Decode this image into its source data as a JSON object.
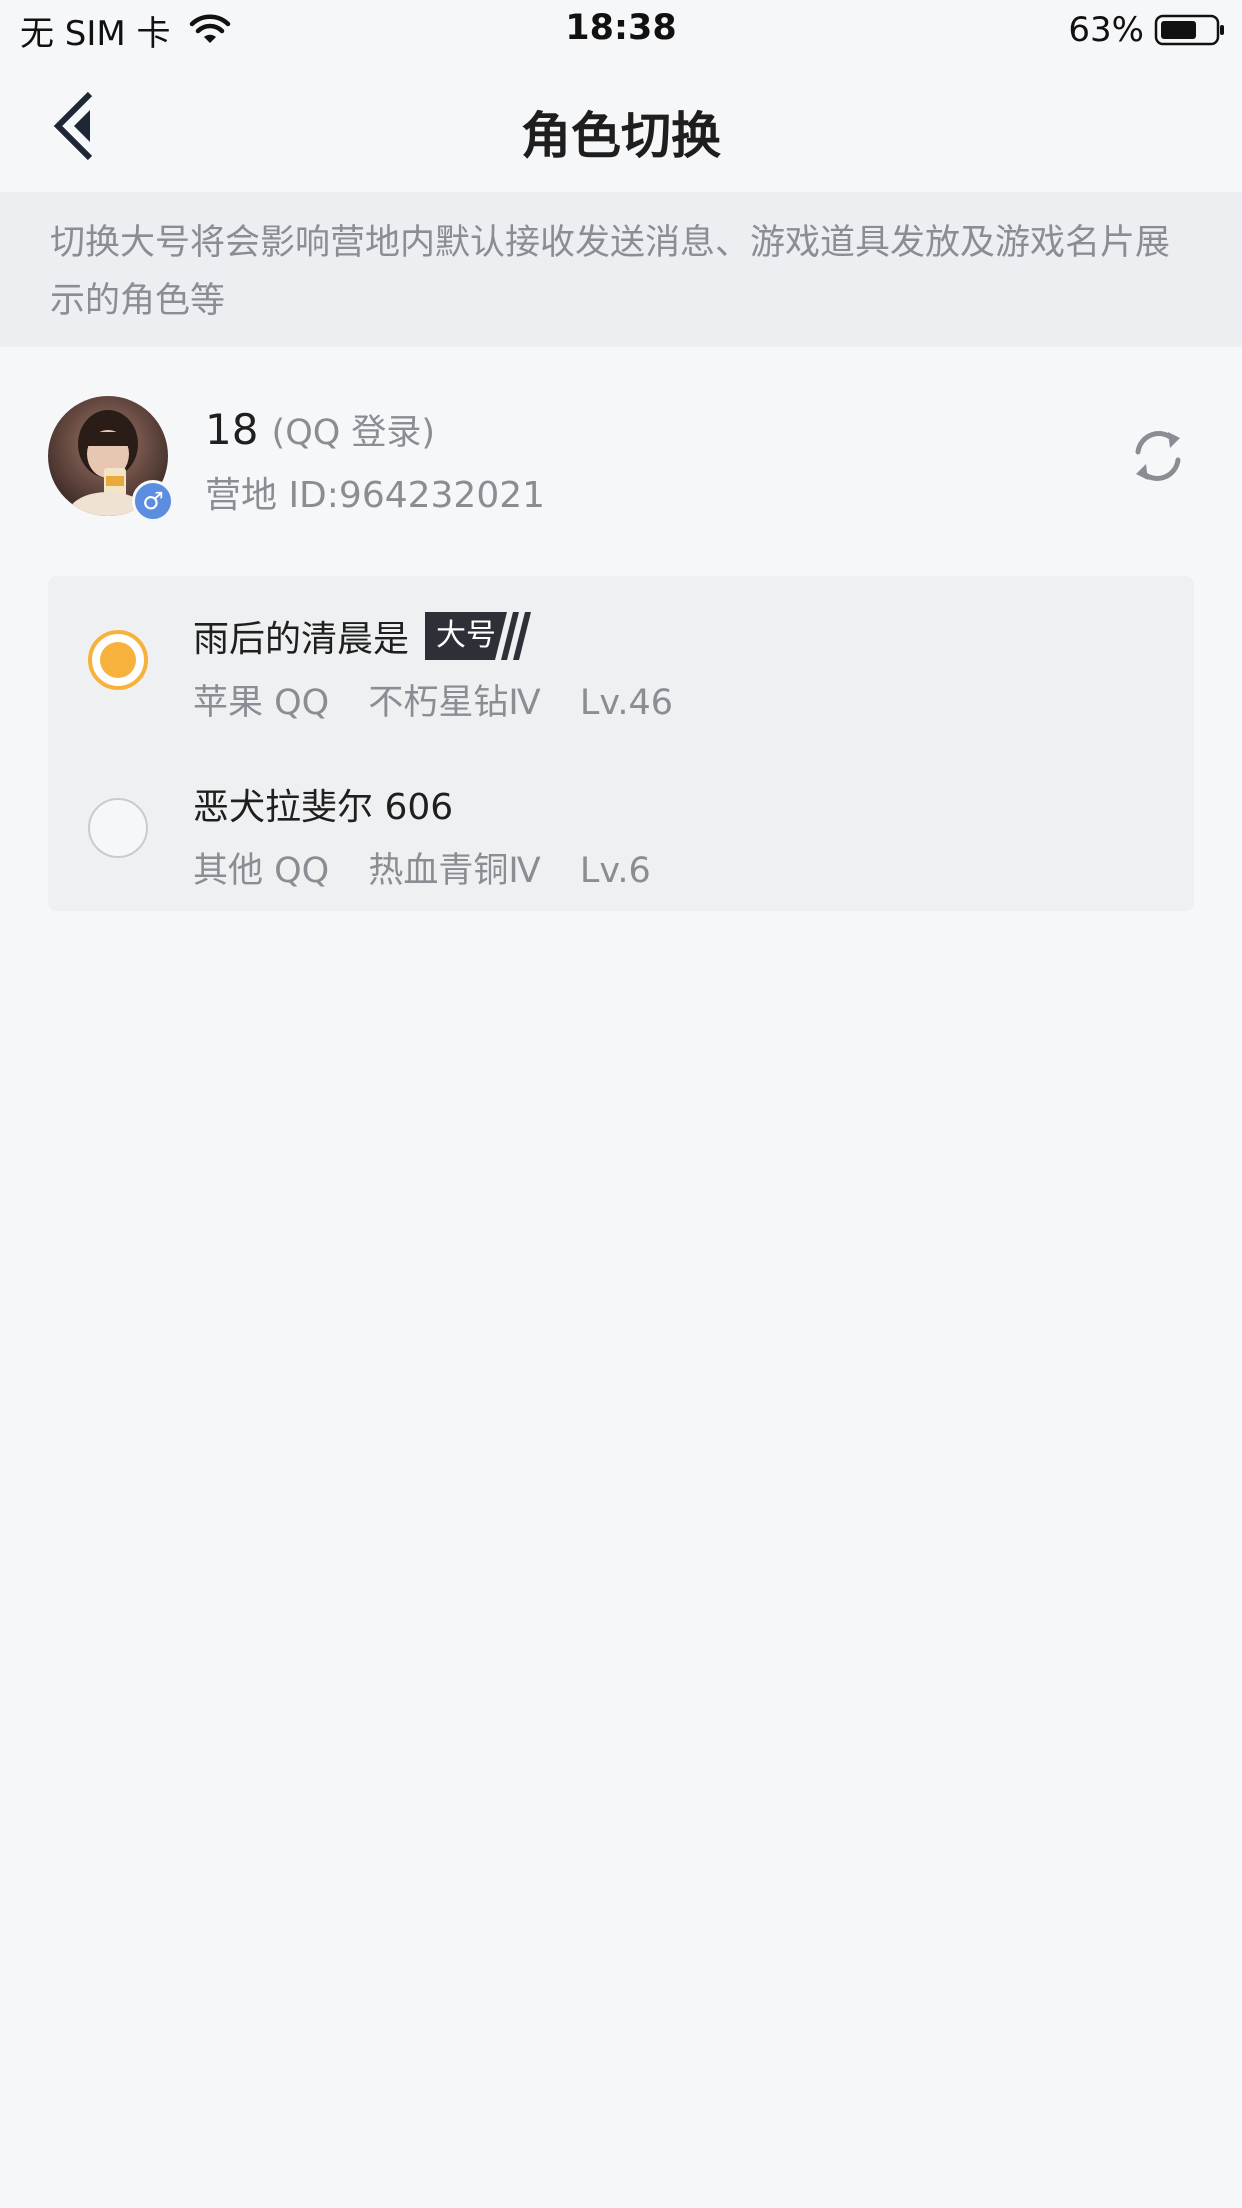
{
  "status_bar": {
    "carrier": "无 SIM 卡",
    "time": "18:38",
    "battery": "63%"
  },
  "nav": {
    "title": "角色切换",
    "back_icon": "chevron-left-icon"
  },
  "notice": {
    "text": "切换大号将会影响营地内默认接收发送消息、游戏道具发放及游戏名片展示的角色等"
  },
  "account": {
    "name": "18",
    "login_type": "(QQ 登录)",
    "camp_id": "营地 ID:964232021",
    "gender_icon": "♂",
    "refresh_icon": "refresh-icon"
  },
  "roles": [
    {
      "name": "雨后的清晨是",
      "badge": "大号",
      "platform": "苹果 QQ",
      "rank": "不朽星钻Ⅳ",
      "level": "Lv.46",
      "selected": true
    },
    {
      "name": "恶犬拉斐尔 606",
      "platform": "其他 QQ",
      "rank": "热血青铜Ⅳ",
      "level": "Lv.6",
      "selected": false
    }
  ],
  "colors": {
    "accent": "#f6b23d",
    "badge_dark": "#2e3038",
    "background": "#f6f7f9",
    "notice_bg": "#eceef1"
  }
}
